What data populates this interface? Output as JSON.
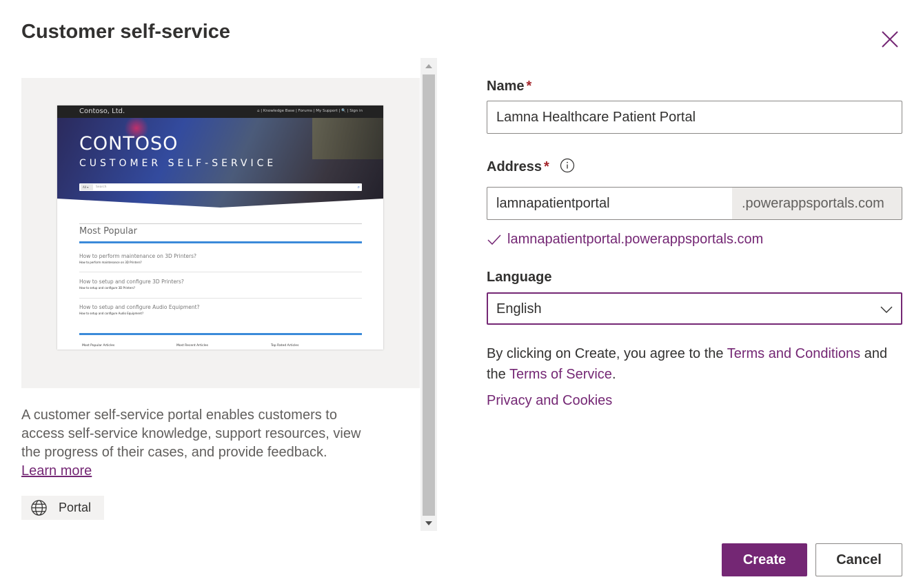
{
  "dialog": {
    "title": "Customer self-service",
    "close_icon": "close-icon"
  },
  "preview": {
    "brand": "Contoso, Ltd.",
    "nav_links": "⌂  |  Knowledge Base  |  Forums  |  My Support  |  🔍  |  Sign in",
    "hero_title": "CONTOSO",
    "hero_subtitle": "CUSTOMER SELF-SERVICE",
    "search_scope": "All ▾",
    "search_placeholder": "Search",
    "section_title": "Most Popular",
    "items": [
      {
        "question": "How to perform maintenance on 3D Printers?",
        "snippet": "How to perform maintenance on 3D Printers?"
      },
      {
        "question": "How to setup and configure 3D Printers?",
        "snippet": "How to setup and configure 3D Printers?"
      },
      {
        "question": "How to setup and configure Audio Equipment?",
        "snippet": "How to setup and configure Audio Equipment?"
      }
    ],
    "columns": [
      "Most Popular Articles",
      "Most Recent Articles",
      "Top Rated Articles"
    ]
  },
  "description": {
    "text": "A customer self-service portal enables customers to access self-service knowledge, support resources, view the progress of their cases, and provide feedback.",
    "learn_more": "Learn more"
  },
  "tag": {
    "icon": "globe-icon",
    "label": "Portal"
  },
  "form": {
    "name_label": "Name",
    "name_value": "Lamna Healthcare Patient Portal",
    "address_label": "Address",
    "address_value": "lamnapatientportal",
    "address_suffix": ".powerappsportals.com",
    "address_valid": "lamnapatientportal.powerappsportals.com",
    "language_label": "Language",
    "language_value": "English",
    "required_marker": "*"
  },
  "legal": {
    "prefix": "By clicking on Create, you agree to the ",
    "terms_conditions": "Terms and Conditions",
    "middle": " and the ",
    "terms_service": "Terms of Service",
    "suffix": ".",
    "privacy": "Privacy and Cookies"
  },
  "buttons": {
    "create": "Create",
    "cancel": "Cancel"
  },
  "colors": {
    "accent": "#742774",
    "required": "#a4262c",
    "preview_bg": "#f3f2f1"
  }
}
